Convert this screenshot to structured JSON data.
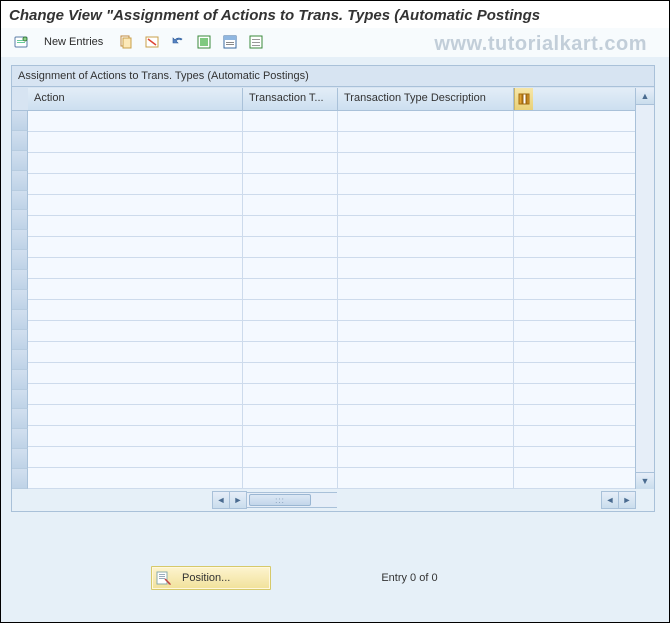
{
  "title": "Change View \"Assignment of Actions to Trans. Types (Automatic Postings",
  "watermark": "www.tutorialkart.com",
  "toolbar": {
    "new_entries": "New Entries"
  },
  "panel": {
    "title": "Assignment of Actions to Trans. Types (Automatic Postings)"
  },
  "columns": {
    "action": "Action",
    "ttype": "Transaction T...",
    "tdesc": "Transaction Type Description"
  },
  "footer": {
    "position": "Position...",
    "entry": "Entry 0 of 0"
  }
}
